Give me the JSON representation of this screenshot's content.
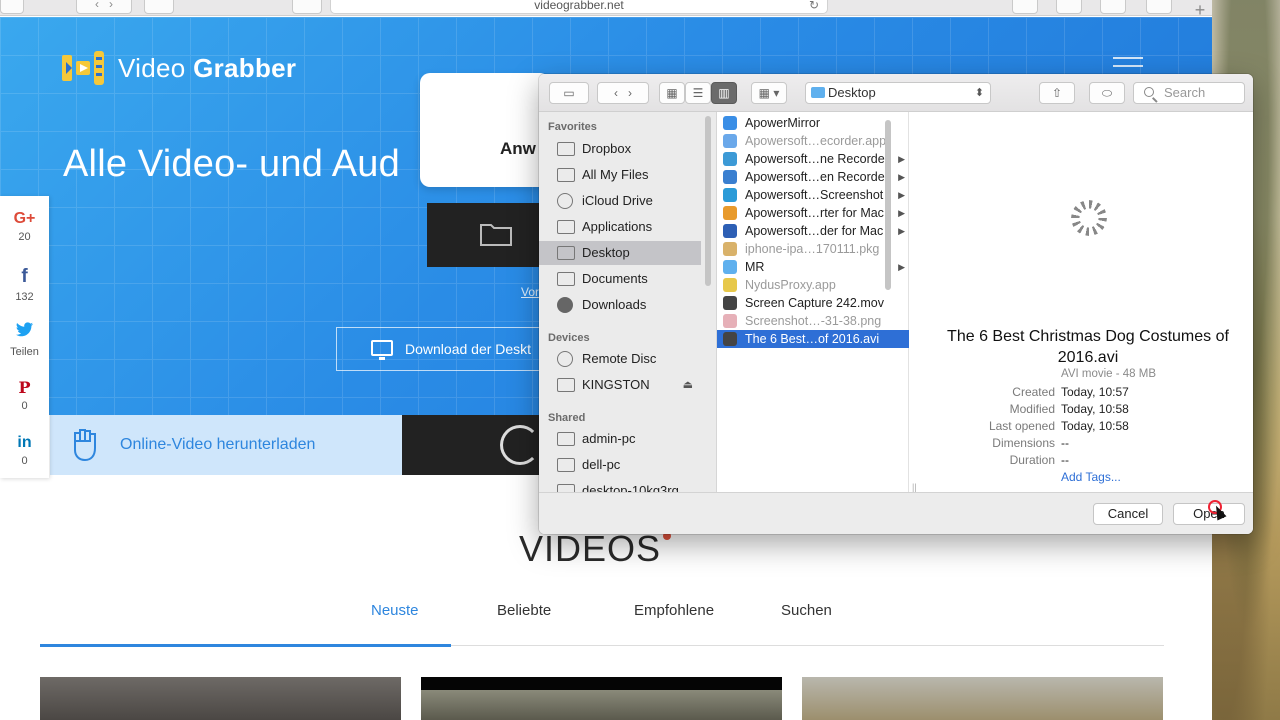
{
  "browser": {
    "url": "videograbber.net",
    "new_tab_symbol": "+"
  },
  "site": {
    "logo": {
      "part1": "Video ",
      "part2": "Grabber"
    },
    "hero_title": "Alle Video- und Aud",
    "card_text": "Anw",
    "link_text": "Vor",
    "download_button": "Download der Deskt",
    "band_text": "Online-Video herunterladen",
    "share": [
      {
        "icon": "G+",
        "count": "20",
        "color": "#dd4b39"
      },
      {
        "icon": "f",
        "count": "132",
        "color": "#3b5998"
      },
      {
        "icon": "t",
        "count": "Teilen",
        "color": "#1da1f2"
      },
      {
        "icon": "P",
        "count": "0",
        "color": "#bd081c"
      },
      {
        "icon": "in",
        "count": "0",
        "color": "#0077b5"
      }
    ],
    "videos_title": "VIDEOS",
    "tabs": [
      "Neuste",
      "Beliebte",
      "Empfohlene",
      "Suchen"
    ],
    "active_tab": "Neuste"
  },
  "dialog": {
    "location": "Desktop",
    "search_placeholder": "Search",
    "sidebar": {
      "favorites_header": "Favorites",
      "favorites": [
        "Dropbox",
        "All My Files",
        "iCloud Drive",
        "Applications",
        "Desktop",
        "Documents",
        "Downloads"
      ],
      "selected": "Desktop",
      "devices_header": "Devices",
      "devices": [
        "Remote Disc",
        "KINGSTON"
      ],
      "shared_header": "Shared",
      "shared": [
        "admin-pc",
        "dell-pc",
        "desktop-10kg3rg"
      ]
    },
    "files": [
      {
        "name": "ApowerMirror",
        "dim": false,
        "folder": false,
        "color": "#3a8ee6"
      },
      {
        "name": "Apowersoft…ecorder.app",
        "dim": true,
        "folder": false,
        "color": "#6aa8ea"
      },
      {
        "name": "Apowersoft…ne Recorder",
        "dim": false,
        "folder": true,
        "color": "#3c9ad6"
      },
      {
        "name": "Apowersoft…en Recorder",
        "dim": false,
        "folder": true,
        "color": "#3a7fd0"
      },
      {
        "name": "Apowersoft…Screenshot",
        "dim": false,
        "folder": true,
        "color": "#2b9bd8"
      },
      {
        "name": "Apowersoft…rter for Mac",
        "dim": false,
        "folder": true,
        "color": "#e89a2c"
      },
      {
        "name": "Apowersoft…der for Mac",
        "dim": false,
        "folder": true,
        "color": "#2d5fb5"
      },
      {
        "name": "iphone-ipa…170111.pkg",
        "dim": true,
        "folder": false,
        "color": "#d9b26a"
      },
      {
        "name": "MR",
        "dim": false,
        "folder": true,
        "color": "#5fb0ee"
      },
      {
        "name": "NydusProxy.app",
        "dim": true,
        "folder": false,
        "color": "#e7c84a"
      },
      {
        "name": "Screen Capture 242.mov",
        "dim": false,
        "folder": false,
        "color": "#444444"
      },
      {
        "name": "Screenshot…-31-38.png",
        "dim": true,
        "folder": false,
        "color": "#e6b0b8"
      },
      {
        "name": "The 6 Best…of 2016.avi",
        "dim": false,
        "folder": false,
        "color": "#444444",
        "selected": true
      }
    ],
    "preview": {
      "title": "The 6 Best Christmas Dog Costumes of 2016.avi",
      "subtitle": "AVI movie - 48 MB",
      "fields": [
        {
          "label": "Created",
          "value": "Today, 10:57"
        },
        {
          "label": "Modified",
          "value": "Today, 10:58"
        },
        {
          "label": "Last opened",
          "value": "Today, 10:58"
        },
        {
          "label": "Dimensions",
          "value": "--"
        },
        {
          "label": "Duration",
          "value": "--"
        }
      ],
      "add_tags": "Add Tags..."
    },
    "cancel_label": "Cancel",
    "open_label": "Open"
  }
}
